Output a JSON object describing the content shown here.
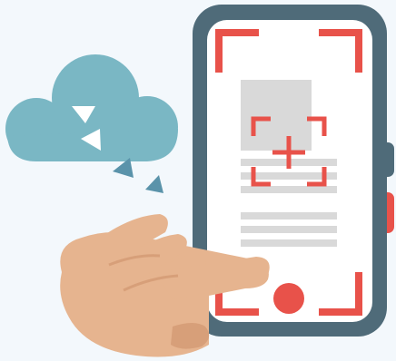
{
  "illustration": {
    "title": "",
    "colors": {
      "background": "#f3f8fc",
      "phone_frame": "#4f6b79",
      "phone_screen": "#ffffff",
      "scan_accent": "#e8524a",
      "cloud": "#7ab7c4",
      "cloud_arrow": "#5a93aa",
      "hand_skin": "#e6b48f",
      "hand_shadow": "#d79f79",
      "content_gray": "#d9d9d9",
      "side_button_dark": "#4f6b79",
      "side_button_red": "#e8524a"
    },
    "icons": [
      "cloud-upload-icon",
      "smartphone-icon",
      "scan-frame-icon",
      "focus-crosshair-icon",
      "shutter-button-icon",
      "hand-pointer-icon"
    ]
  }
}
